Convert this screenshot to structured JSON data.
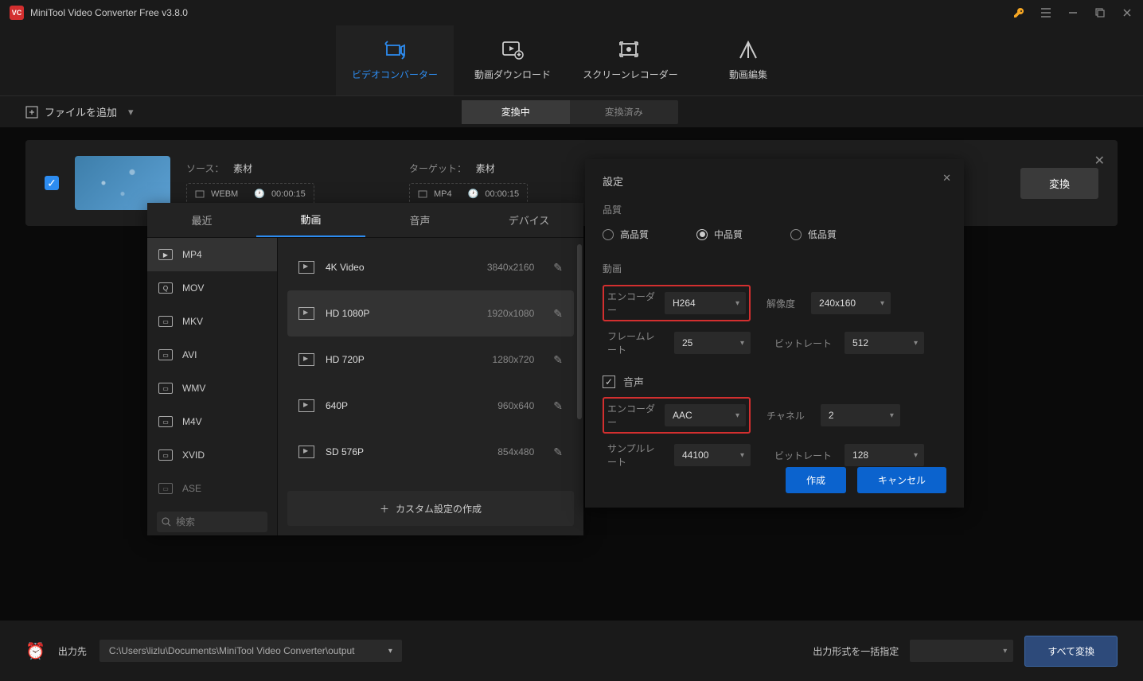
{
  "app": {
    "title": "MiniTool Video Converter Free v3.8.0"
  },
  "nav": {
    "converter": "ビデオコンバーター",
    "download": "動画ダウンロード",
    "recorder": "スクリーンレコーダー",
    "editor": "動画編集"
  },
  "subbar": {
    "add_file": "ファイルを追加",
    "tab_converting": "変換中",
    "tab_converted": "変換済み"
  },
  "file": {
    "source_label": "ソース：",
    "source_name": "素材",
    "source_format": "WEBM",
    "source_duration": "00:00:15",
    "target_label": "ターゲット：",
    "target_name": "素材",
    "target_format": "MP4",
    "target_duration": "00:00:15",
    "convert_btn": "変換"
  },
  "format": {
    "tabs": {
      "recent": "最近",
      "video": "動画",
      "audio": "音声",
      "device": "デバイス"
    },
    "sidebar": [
      "MP4",
      "MOV",
      "MKV",
      "AVI",
      "WMV",
      "M4V",
      "XVID",
      "ASE"
    ],
    "search_placeholder": "検索",
    "resolutions": [
      {
        "name": "4K Video",
        "dim": "3840x2160"
      },
      {
        "name": "HD 1080P",
        "dim": "1920x1080"
      },
      {
        "name": "HD 720P",
        "dim": "1280x720"
      },
      {
        "name": "640P",
        "dim": "960x640"
      },
      {
        "name": "SD 576P",
        "dim": "854x480"
      }
    ],
    "custom": "カスタム設定の作成"
  },
  "settings": {
    "title": "設定",
    "quality_label": "品質",
    "quality": {
      "high": "高品質",
      "medium": "中品質",
      "low": "低品質"
    },
    "video_label": "動画",
    "encoder_label": "エンコーダー",
    "encoder_value": "H264",
    "resolution_label": "解像度",
    "resolution_value": "240x160",
    "framerate_label": "フレームレート",
    "framerate_value": "25",
    "vbitrate_label": "ビットレート",
    "vbitrate_value": "512",
    "audio_label": "音声",
    "aencoder_value": "AAC",
    "channel_label": "チャネル",
    "channel_value": "2",
    "samplerate_label": "サンプルレート",
    "samplerate_value": "44100",
    "abitrate_label": "ビットレート",
    "abitrate_value": "128",
    "create": "作成",
    "cancel": "キャンセル"
  },
  "footer": {
    "output_label": "出力先",
    "output_path": "C:\\Users\\lizlu\\Documents\\MiniTool Video Converter\\output",
    "batch_label": "出力形式を一括指定",
    "convert_all": "すべて変換"
  }
}
